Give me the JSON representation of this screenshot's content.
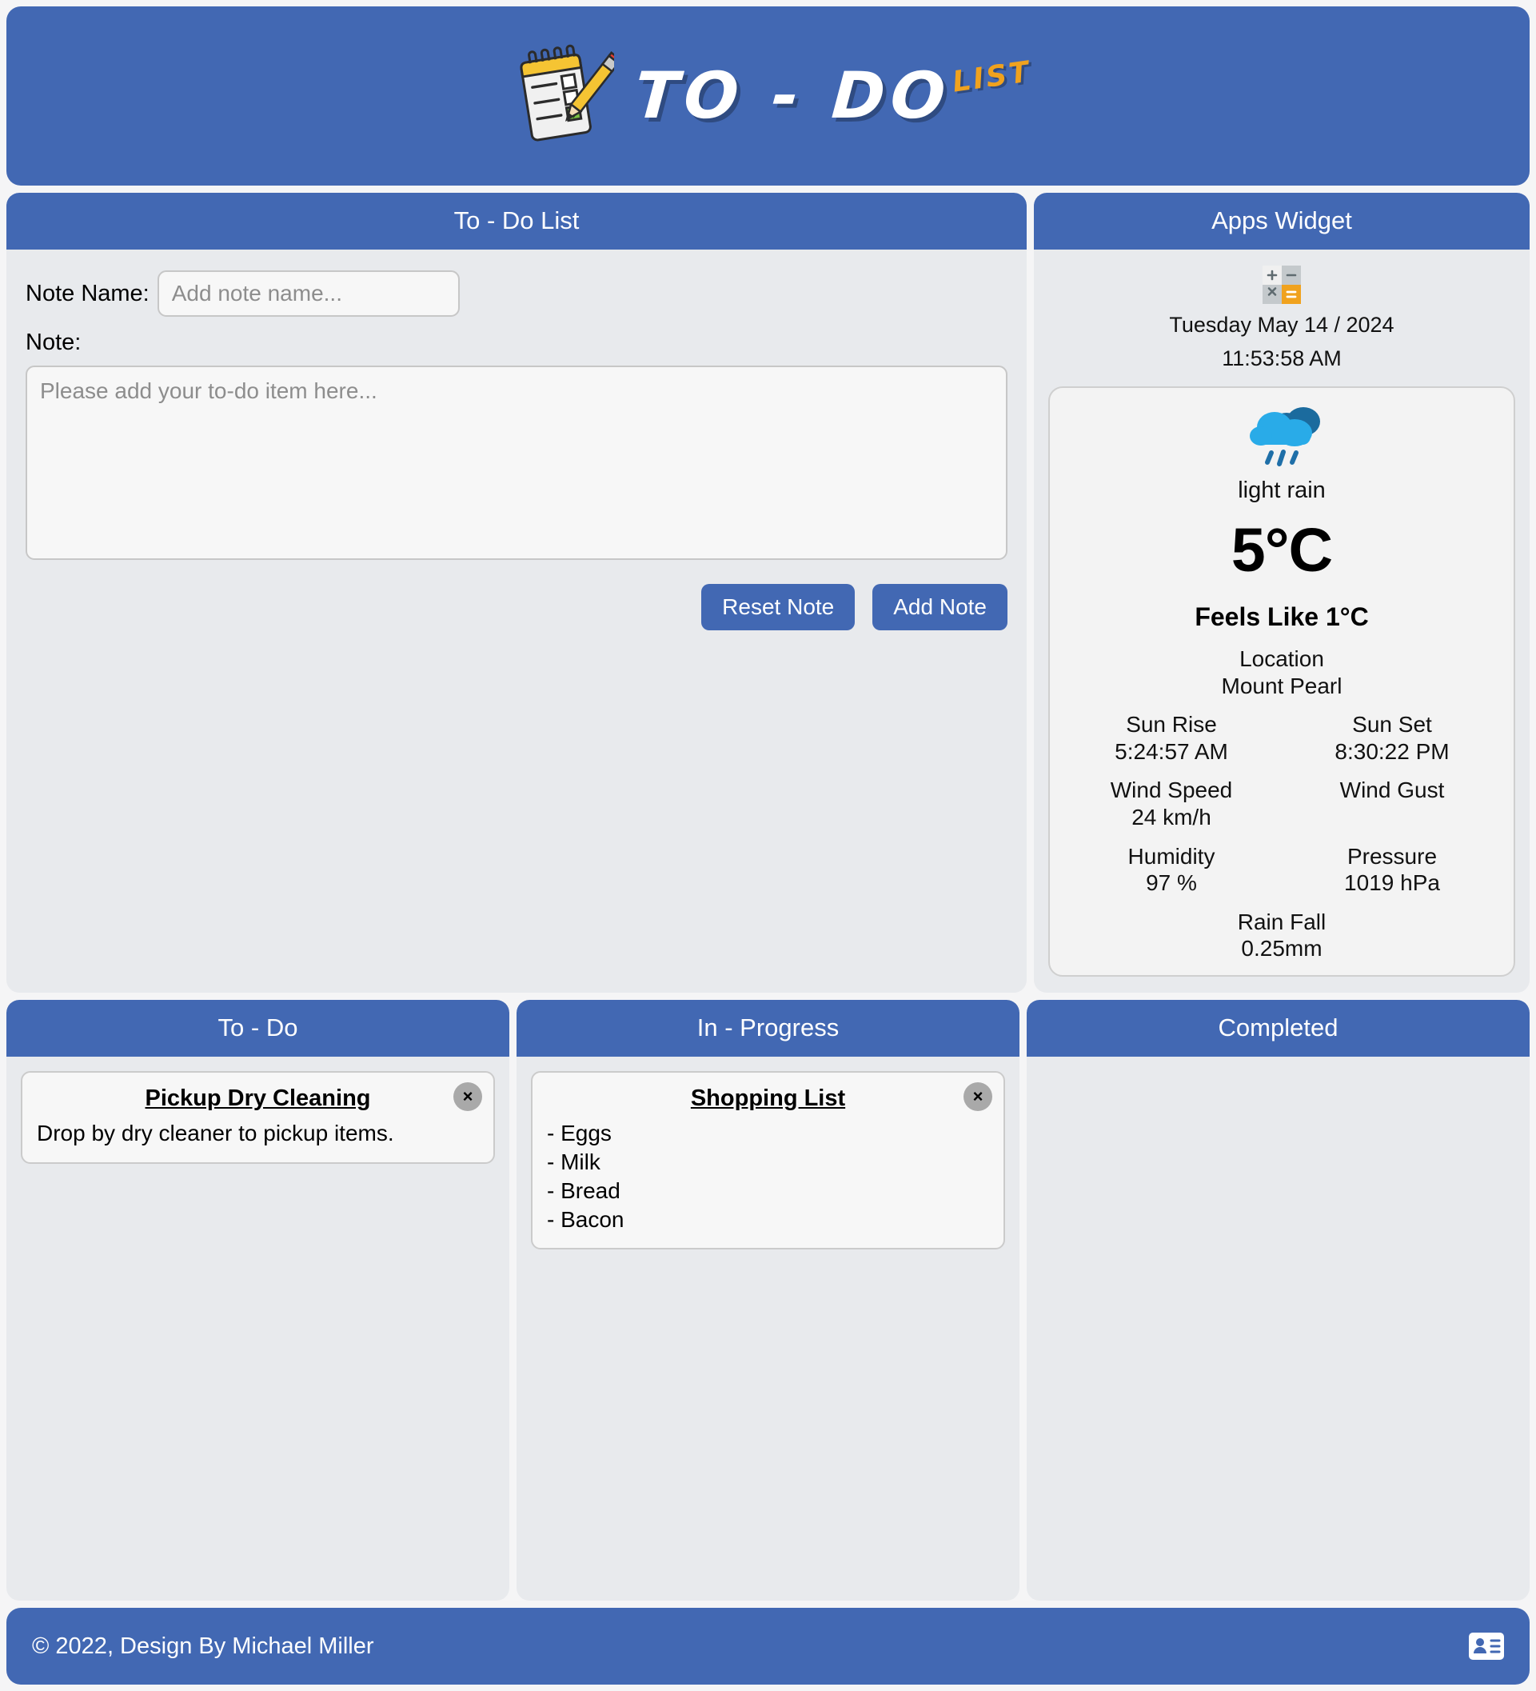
{
  "header": {
    "brand_main": "TO - DO",
    "brand_sup": "LIST",
    "notepad_icon": "notepad-pencil-icon"
  },
  "todo_panel": {
    "title": "To - Do List",
    "note_name_label": "Note Name:",
    "note_name_placeholder": "Add note name...",
    "note_name_value": "",
    "note_label": "Note:",
    "note_placeholder": "Please add your to-do item here...",
    "note_value": "",
    "reset_button": "Reset Note",
    "add_button": "Add Note"
  },
  "widget": {
    "title": "Apps Widget",
    "calculator_icon": "calculator-icon",
    "calculator_keys": [
      "+",
      "−",
      "×",
      "="
    ],
    "date": "Tuesday May 14 / 2024",
    "time": "11:53:58 AM",
    "weather": {
      "condition_icon": "light-rain-icon",
      "condition": "light rain",
      "temperature": "5°C",
      "feels_like": "Feels Like 1°C",
      "stats": [
        {
          "label": "Location",
          "value": "Mount Pearl",
          "wide": true
        },
        {
          "label": "Sun Rise",
          "value": "5:24:57 AM",
          "wide": false
        },
        {
          "label": "Sun Set",
          "value": "8:30:22 PM",
          "wide": false
        },
        {
          "label": "Wind Speed",
          "value": "24 km/h",
          "wide": false
        },
        {
          "label": "Wind Gust",
          "value": "",
          "wide": false
        },
        {
          "label": "Humidity",
          "value": "97 %",
          "wide": false
        },
        {
          "label": "Pressure",
          "value": "1019 hPa",
          "wide": false
        },
        {
          "label": "Rain Fall",
          "value": "0.25mm",
          "wide": true
        }
      ]
    }
  },
  "columns": [
    {
      "title": "To - Do",
      "cards": [
        {
          "title": "Pickup Dry Cleaning",
          "text": "Drop by dry cleaner to pickup items.",
          "close_label": "×"
        }
      ]
    },
    {
      "title": "In - Progress",
      "cards": [
        {
          "title": "Shopping List",
          "text": "- Eggs\n- Milk\n- Bread\n- Bacon",
          "close_label": "×"
        }
      ]
    },
    {
      "title": "Completed",
      "cards": []
    }
  ],
  "footer": {
    "copyright": "© 2022, Design By Michael Miller",
    "contact_icon": "contact-card-icon"
  },
  "colors": {
    "brand_blue": "#4268b3",
    "panel_bg": "#e8eaed",
    "page_bg": "#f5f5f6",
    "accent_orange": "#f0a21e",
    "rain_blue": "#29abe8",
    "rain_blue_dark": "#1b6b9e"
  }
}
